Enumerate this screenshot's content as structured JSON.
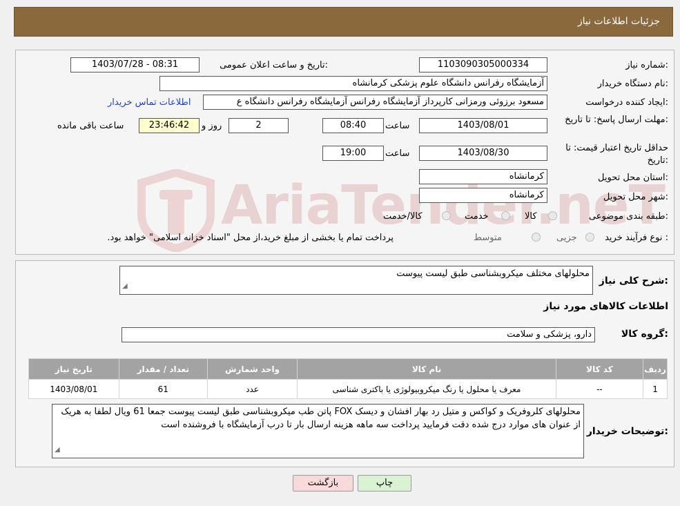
{
  "header": {
    "title": "جزئیات اطلاعات نیاز"
  },
  "fields": {
    "need_number_label": "شماره نیاز:",
    "need_number": "1103090305000334",
    "announce_label": "تاریخ و ساعت اعلان عمومی:",
    "announce_value": "1403/07/28 - 08:31",
    "buyer_org_label": "نام دستگاه خریدار:",
    "buyer_org": "آزمایشگاه رفرانس دانشگاه علوم پزشکی کرمانشاه",
    "creator_label": "ایجاد کننده درخواست:",
    "creator": "مسعود برزوئی ورمزانی کارپرداز آزمایشگاه رفرانس آزمایشگاه رفرانس دانشگاه ع",
    "contact_link": "اطلاعات تماس خریدار",
    "deadline_label": "مهلت ارسال پاسخ: تا تاریخ:",
    "deadline_date": "1403/08/01",
    "time_label": "ساعت",
    "deadline_time": "08:40",
    "days_value": "2",
    "days_label": "روز و",
    "remaining_value": "23:46:42",
    "remaining_label": "ساعت باقی مانده",
    "validity_label": "حداقل تاریخ اعتبار قیمت: تا تاریخ:",
    "validity_date": "1403/08/30",
    "validity_time": "19:00",
    "province_label": "استان محل تحویل:",
    "province": "کرمانشاه",
    "city_label": "شهر محل تحویل:",
    "city": "کرمانشاه",
    "category_label": "طبقه بندی موضوعی:",
    "category_options": [
      "کالا",
      "خدمت",
      "کالا/خدمت"
    ],
    "process_label": "نوع فرآیند خرید :",
    "process_options": [
      "جزیی",
      "متوسط"
    ],
    "process_note": "پرداخت تمام یا بخشی از مبلغ خرید،از محل \"اسناد خزانه اسلامی\" خواهد بود."
  },
  "description": {
    "label": "شرح کلی نیاز:",
    "value": "محلولهای مختلف میکروبشناسی طبق لیست پیوست"
  },
  "goods": {
    "section_title": "اطلاعات کالاهای مورد نیاز",
    "group_label": "گروه کالا:",
    "group_value": "دارو، پزشکی و سلامت",
    "columns": [
      "ردیف",
      "کد کالا",
      "نام کالا",
      "واحد شمارش",
      "تعداد / مقدار",
      "تاریخ نیاز"
    ],
    "rows": [
      [
        "1",
        "--",
        "معرف یا محلول یا رنگ میکروبیولوژی یا باکتری شناسی",
        "عدد",
        "61",
        "1403/08/01"
      ]
    ]
  },
  "buyer_notes": {
    "label": "توضیحات خریدار:",
    "value": "محلولهای کلروفریک و کواکس و متیل رد بهار افشان و دیسک FOX پاتن طب میکروبشناسی طبق لیست پیوست جمعا 61 ویال لطفا به هریک از عنوان های موارد درج شده دقت فرمایید پرداخت سه ماهه هزینه ارسال بار تا درب آزمایشگاه با فروشنده است"
  },
  "buttons": {
    "print": "چاپ",
    "back": "بازگشت"
  },
  "watermark": {
    "text": "AriaTender.neT"
  },
  "colors": {
    "header": "#8a6a3c",
    "link": "#1a44c8",
    "back_button": "#f8dada",
    "print_button": "#d9f2d4"
  }
}
